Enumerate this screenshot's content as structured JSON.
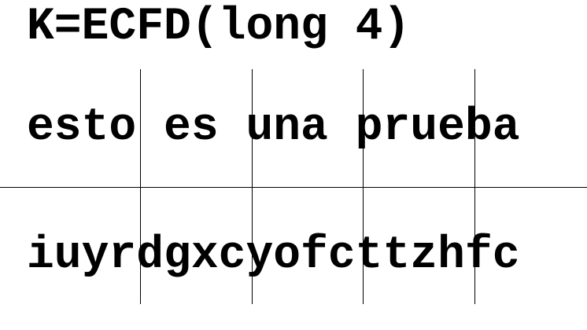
{
  "heading": "K=ECFD(long 4)",
  "plaintext": "esto es una prueba",
  "ciphertext": "iuyrdgxcyofcttzhfc"
}
